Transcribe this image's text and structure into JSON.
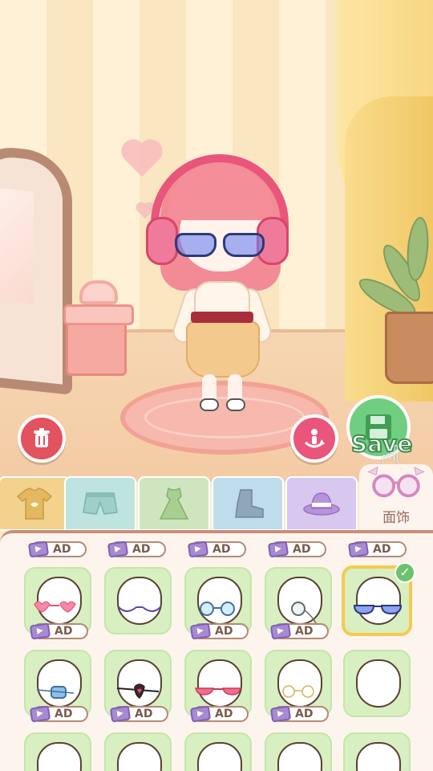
{
  "actions": {
    "save_label": "Save"
  },
  "tabs": {
    "active_label": "面饰",
    "items": [
      {
        "name": "tops",
        "icon": "shirt-icon",
        "color": "#f2d28c"
      },
      {
        "name": "bottoms",
        "icon": "shorts-icon",
        "color": "#bfe3df"
      },
      {
        "name": "dresses",
        "icon": "dress-icon",
        "color": "#cfe5c0"
      },
      {
        "name": "shoes",
        "icon": "boot-icon",
        "color": "#bfdcea"
      },
      {
        "name": "hats",
        "icon": "hat-icon",
        "color": "#d8c7ee"
      }
    ]
  },
  "ad_label": "AD",
  "grid": {
    "rows": [
      [
        {
          "accessory": "pink-heart-glasses",
          "ad": true,
          "selected": false
        },
        {
          "accessory": "purple-thin-glasses",
          "ad": false,
          "selected": false
        },
        {
          "accessory": "blue-round-glasses",
          "ad": true,
          "selected": false
        },
        {
          "accessory": "monocle",
          "ad": true,
          "selected": false
        },
        {
          "accessory": "blue-tinted-glasses",
          "ad": false,
          "selected": true
        }
      ],
      [
        {
          "accessory": "blue-eyepatch",
          "ad": true,
          "selected": false
        },
        {
          "accessory": "heart-eyepatch",
          "ad": true,
          "selected": false
        },
        {
          "accessory": "pink-cat-glasses",
          "ad": true,
          "selected": false
        },
        {
          "accessory": "gold-round-glasses",
          "ad": true,
          "selected": false
        },
        {
          "accessory": "none",
          "ad": false,
          "selected": false
        }
      ]
    ]
  },
  "colors": {
    "panel_border": "#c68f7a",
    "cell_bg": "#d8efc2",
    "selected_border": "#f6c94d",
    "accent_pink": "#e9557b"
  }
}
